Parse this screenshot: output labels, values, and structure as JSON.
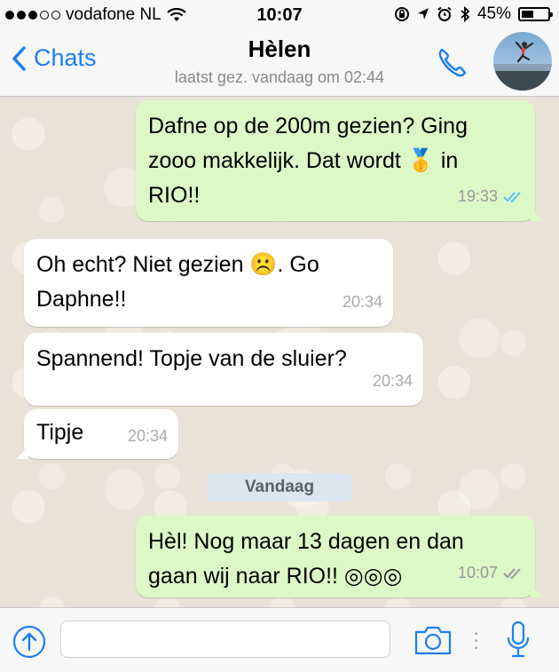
{
  "status_bar": {
    "carrier": "vodafone NL",
    "time": "10:07",
    "battery": "45%",
    "battery_level": 0.45
  },
  "header": {
    "back_label": "Chats",
    "contact_name": "Hèlen",
    "last_seen": "laatst gez. vandaag om 02:44"
  },
  "messages": [
    {
      "direction": "outgoing",
      "text_lines": [
        "Dafne op de 200m gezien? Ging",
        "zooo makkelijk. Dat wordt 🥇 in",
        "RIO!!"
      ],
      "time": "19:33",
      "read": true
    },
    {
      "direction": "incoming",
      "text_lines": [
        "Oh echt? Niet gezien ☹️. Go",
        "Daphne!!"
      ],
      "time": "20:34"
    },
    {
      "direction": "incoming",
      "text_lines": [
        "Spannend! Topje van de sluier?"
      ],
      "time": "20:34"
    },
    {
      "direction": "incoming",
      "text_lines": [
        "Tipje"
      ],
      "time": "20:34"
    },
    {
      "direction": "outgoing",
      "text_lines": [
        "Hèl! Nog maar 13 dagen en dan",
        "gaan wij naar RIO!! ◎◎◎"
      ],
      "time": "10:07",
      "read": false
    }
  ],
  "date_separator": "Vandaag",
  "input_bar": {
    "placeholder": "",
    "icons": [
      "upload-icon",
      "camera-icon",
      "microphone-icon"
    ]
  },
  "colors": {
    "accent": "#1a7ef5",
    "outgoing_bubble": "#dcf8c6",
    "incoming_bubble": "#ffffff",
    "read_ticks": "#4fc3f7"
  }
}
